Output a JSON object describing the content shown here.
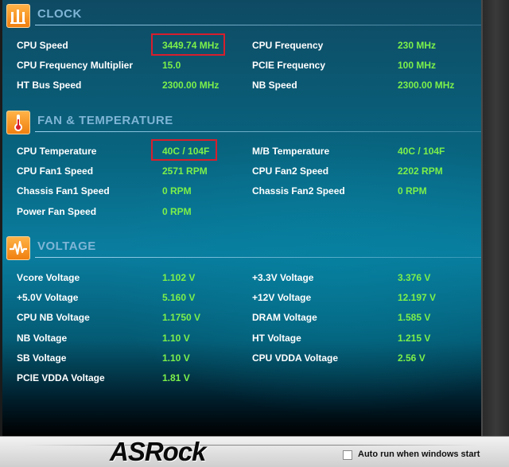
{
  "sections": {
    "clock": {
      "title": "CLOCK",
      "rows": [
        {
          "l1": "CPU Speed",
          "v1": "3449.74 MHz",
          "l2": "CPU Frequency",
          "v2": "230 MHz"
        },
        {
          "l1": "CPU Frequency Multiplier",
          "v1": "15.0",
          "l2": "PCIE Frequency",
          "v2": "100 MHz"
        },
        {
          "l1": "HT Bus Speed",
          "v1": "2300.00 MHz",
          "l2": "NB Speed",
          "v2": "2300.00 MHz"
        }
      ]
    },
    "fan": {
      "title": "FAN & TEMPERATURE",
      "rows": [
        {
          "l1": "CPU Temperature",
          "v1": "40C / 104F",
          "l2": "M/B Temperature",
          "v2": "40C / 104F"
        },
        {
          "l1": "CPU Fan1 Speed",
          "v1": "2571 RPM",
          "l2": "CPU Fan2 Speed",
          "v2": "2202 RPM"
        },
        {
          "l1": "Chassis Fan1 Speed",
          "v1": "0 RPM",
          "l2": "Chassis Fan2 Speed",
          "v2": "0 RPM"
        },
        {
          "l1": "Power Fan Speed",
          "v1": "0 RPM"
        }
      ]
    },
    "voltage": {
      "title": "VOLTAGE",
      "rows": [
        {
          "l1": "Vcore Voltage",
          "v1": "1.102 V",
          "l2": "+3.3V Voltage",
          "v2": "3.376 V"
        },
        {
          "l1": "+5.0V Voltage",
          "v1": "5.160 V",
          "l2": "+12V Voltage",
          "v2": "12.197 V"
        },
        {
          "l1": "CPU NB Voltage",
          "v1": "1.1750 V",
          "l2": "DRAM Voltage",
          "v2": "1.585 V"
        },
        {
          "l1": "NB Voltage",
          "v1": "1.10 V",
          "l2": "HT Voltage",
          "v2": "1.215 V"
        },
        {
          "l1": "SB Voltage",
          "v1": "1.10 V",
          "l2": "CPU VDDA Voltage",
          "v2": "2.56 V"
        },
        {
          "l1": "PCIE VDDA Voltage",
          "v1": "1.81 V"
        }
      ]
    }
  },
  "icons": {
    "clock": "clock-bars-icon",
    "fan": "thermometer-icon",
    "voltage": "voltage-wave-icon"
  },
  "colors": {
    "value": "#7cf04a",
    "label": "#ffffff",
    "section_title": "#7fb5d6",
    "highlight": "#d81e2c",
    "icon_orange": "#f07f10"
  },
  "footer": {
    "brand": "ASRock",
    "autorun_label": "Auto run when windows start",
    "autorun_checked": false
  }
}
